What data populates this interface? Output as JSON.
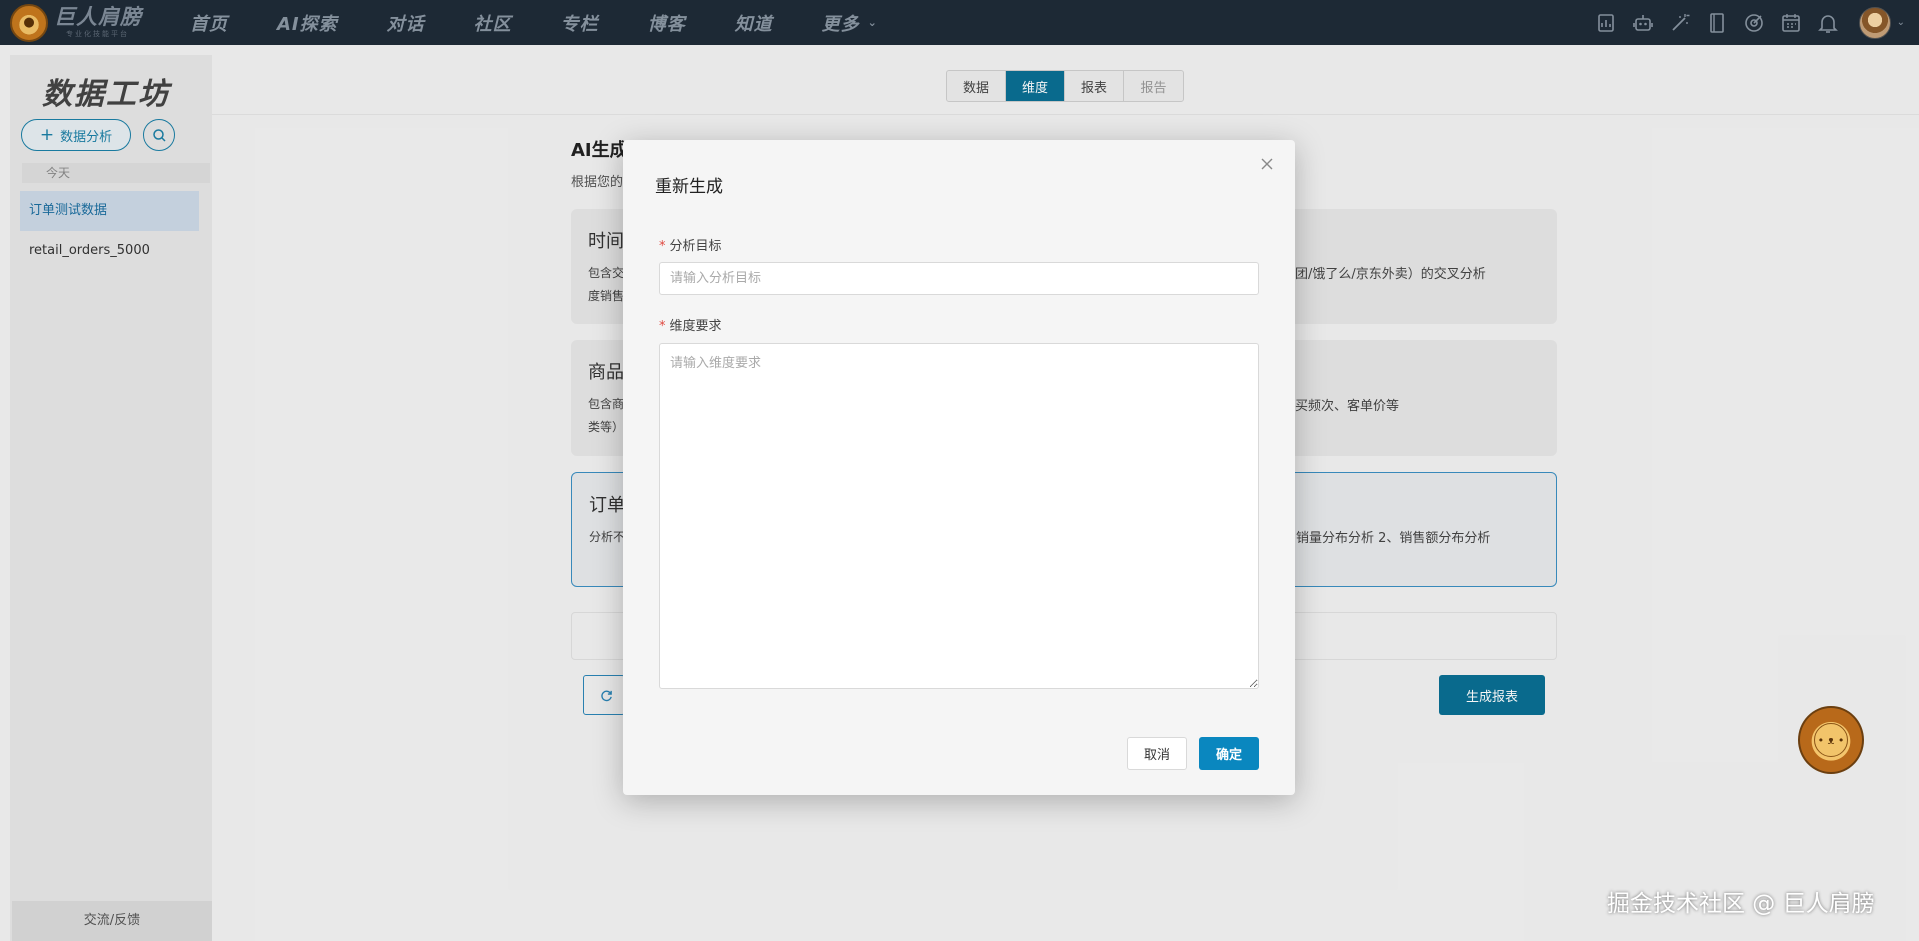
{
  "topnav": {
    "logo_text": "巨人肩膀",
    "logo_sub": "专业化技能平台",
    "items": [
      "首页",
      "AI探索",
      "对话",
      "社区",
      "专栏",
      "博客",
      "知道",
      "更多"
    ]
  },
  "sidebar": {
    "title": "数据工坊",
    "new_analysis_label": "数据分析",
    "group_label": "今天",
    "items": [
      {
        "label": "订单测试数据"
      },
      {
        "label": "retail_orders_5000"
      }
    ],
    "footer_label": "交流/反馈"
  },
  "tabs": [
    {
      "label": "数据"
    },
    {
      "label": "维度"
    },
    {
      "label": "报表"
    },
    {
      "label": "报告"
    }
  ],
  "content": {
    "title": "AI生成",
    "description": "根据您的",
    "cards": [
      {
        "heading": "时间",
        "text1": "包含交",
        "text2": "度销售",
        "right_text": "美团/饿了么/京东外卖）的交叉分析"
      },
      {
        "heading": "商品",
        "text1": "包含商",
        "text2": "类等）",
        "right_text": "购买频次、客单价等"
      },
      {
        "heading": "订单",
        "text1": "分析不",
        "text2": "",
        "right_text": "、销量分布分析 2、销售额分布分析"
      }
    ],
    "generate_button": "生成报表"
  },
  "modal": {
    "title": "重新生成",
    "goal_label": "分析目标",
    "goal_placeholder": "请输入分析目标",
    "dimension_label": "维度要求",
    "dimension_placeholder": "请输入维度要求",
    "cancel_label": "取消",
    "confirm_label": "确定"
  },
  "watermark": "掘金技术社区 @ 巨人肩膀",
  "colors": {
    "topnav_bg": "#1f2b38",
    "accent": "#0a6f93",
    "confirm": "#0a87bf",
    "required": "#e0473f"
  }
}
